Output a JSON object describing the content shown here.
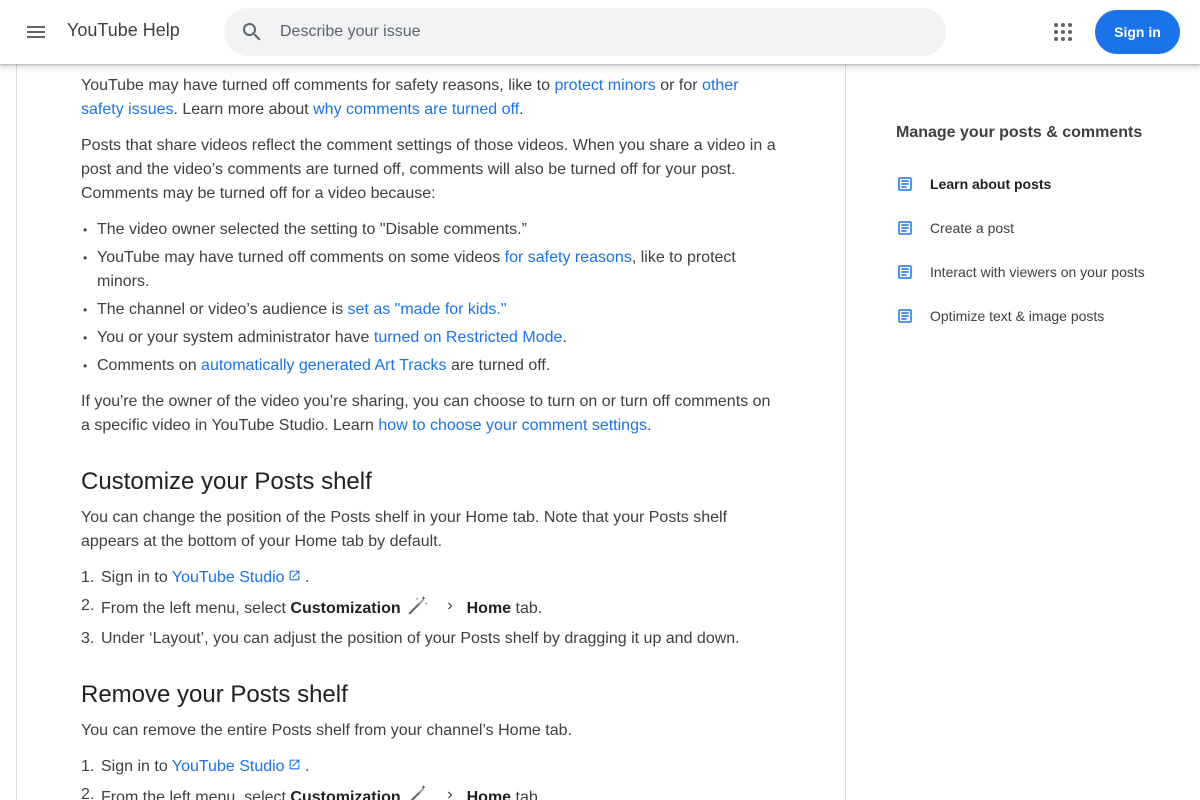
{
  "header": {
    "app_title": "YouTube Help",
    "search_placeholder": "Describe your issue",
    "signin_label": "Sign in"
  },
  "article": {
    "intro": {
      "p1_a": "YouTube may have turned off comments for safety reasons, like to ",
      "p1_link1": "protect minors",
      "p1_b": " or for ",
      "p1_link2": "other safety issues",
      "p1_c": ". Learn more about ",
      "p1_link3": "why comments are turned off",
      "p1_d": ".",
      "p2": "Posts that share videos reflect the comment settings of those videos. When you share a video in a post and the video’s comments are turned off, comments will also be turned off for your post. Comments may be turned off for a video because:"
    },
    "reasons": {
      "r1": "The video owner selected the setting to \"Disable comments.”",
      "r2_a": "YouTube may have turned off comments on some videos ",
      "r2_link": "for safety reasons",
      "r2_b": ", like to protect minors.",
      "r3_a": "The channel or video’s audience is ",
      "r3_link": "set as \"made for kids.\"",
      "r4_a": "You or your system administrator have ",
      "r4_link": "turned on Restricted Mode",
      "r4_b": ".",
      "r5_a": "Comments on ",
      "r5_link": "automatically generated Art Tracks",
      "r5_b": " are turned off."
    },
    "owner": {
      "a": "If you're the owner of the video you’re sharing, you can choose to turn on or turn off comments on a specific video in YouTube Studio. Learn ",
      "link": "how to choose your comment settings",
      "b": "."
    },
    "customize": {
      "heading": "Customize your Posts shelf",
      "desc": "You can change the position of the Posts shelf in your Home tab. Note that your Posts shelf appears at the bottom of your Home tab by default.",
      "s1_num": "1.",
      "s1_a": "Sign in to ",
      "s1_link": "YouTube Studio",
      "s1_b": " .",
      "s2_num": "2.",
      "s2_a": "From the left menu, select ",
      "s2_bold": "Customization",
      "s2_home": "Home",
      "s2_b": " tab.",
      "s3_num": "3.",
      "s3": "Under ‘Layout’, you can adjust the position of your Posts shelf by dragging it up and down."
    },
    "remove": {
      "heading": "Remove your Posts shelf",
      "desc": "You can remove the entire Posts shelf from your channel’s Home tab.",
      "s1_num": "1.",
      "s1_a": "Sign in to ",
      "s1_link": "YouTube Studio",
      "s1_b": " .",
      "s2_num": "2.",
      "s2_a": "From the left menu, select ",
      "s2_bold": "Customization",
      "s2_home": "Home",
      "s2_b": " tab."
    }
  },
  "sidebar": {
    "title": "Manage your posts & comments",
    "items": [
      {
        "label": "Learn about posts",
        "icon": "article-icon"
      },
      {
        "label": "Create a post",
        "icon": "article-icon"
      },
      {
        "label": "Interact with viewers on your posts",
        "icon": "article-icon"
      },
      {
        "label": "Optimize text & image posts",
        "icon": "article-icon"
      }
    ]
  },
  "colors": {
    "link": "#1a73e8",
    "signin_bg": "#1a73e8",
    "search_bg": "#f1f3f4"
  }
}
